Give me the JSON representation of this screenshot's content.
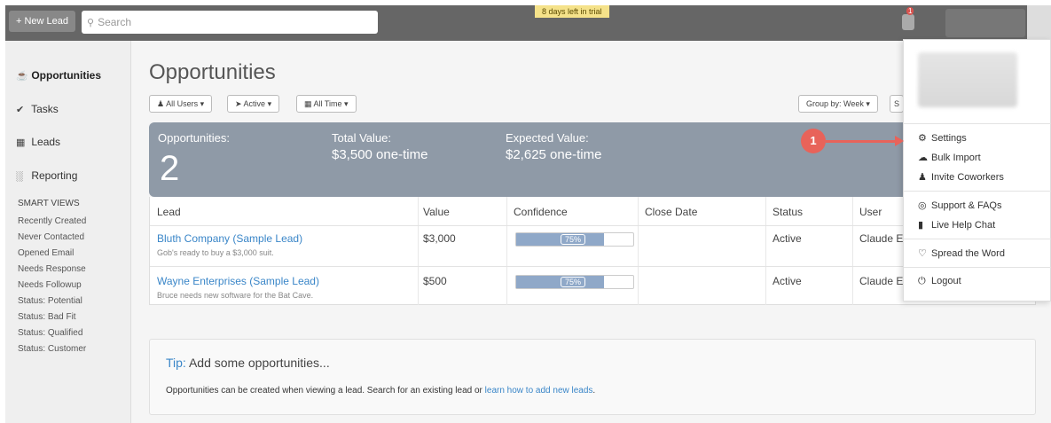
{
  "topbar": {
    "new_lead_label": "+ New Lead",
    "search_placeholder": "Search",
    "trial_text": "8 days left in trial",
    "notification_count": "1"
  },
  "sidebar": {
    "nav": [
      {
        "label": "Opportunities",
        "icon": "trophy-icon"
      },
      {
        "label": "Tasks",
        "icon": "check-icon"
      },
      {
        "label": "Leads",
        "icon": "leads-icon"
      },
      {
        "label": "Reporting",
        "icon": "bar-chart-icon"
      }
    ],
    "smart_views_heading": "SMART VIEWS",
    "smart_views": [
      "Recently Created",
      "Never Contacted",
      "Opened Email",
      "Needs Response",
      "Needs Followup",
      "Status: Potential",
      "Status: Bad Fit",
      "Status: Qualified",
      "Status: Customer"
    ]
  },
  "main": {
    "title": "Opportunities",
    "filters": {
      "users": "All Users",
      "status": "Active",
      "time": "All Time",
      "group_by": "Group by: Week",
      "truncated": "S"
    },
    "summary": {
      "count_label": "Opportunities:",
      "count_value": "2",
      "total_label": "Total Value:",
      "total_value": "$3,500 one-time",
      "expected_label": "Expected Value:",
      "expected_value": "$2,625 one-time"
    },
    "table": {
      "headers": [
        "Lead",
        "Value",
        "Confidence",
        "Close Date",
        "Status",
        "User"
      ],
      "rows": [
        {
          "lead": "Bluth Company (Sample Lead)",
          "note": "Gob's ready to buy a $3,000 suit.",
          "value": "$3,000",
          "confidence": "75%",
          "confidence_pct": 75,
          "close_date": "",
          "status": "Active",
          "user": "Claude El"
        },
        {
          "lead": "Wayne Enterprises (Sample Lead)",
          "note": "Bruce needs new software for the Bat Cave.",
          "value": "$500",
          "confidence": "75%",
          "confidence_pct": 75,
          "close_date": "",
          "status": "Active",
          "user": "Claude El"
        }
      ]
    },
    "tip": {
      "label": "Tip:",
      "heading": "Add some opportunities...",
      "body": "Opportunities can be created when viewing a lead. Search for an existing lead or",
      "link": "learn how to add new leads",
      "end": "."
    }
  },
  "dropdown": {
    "items": [
      {
        "label": "Settings",
        "icon": "gear-icon"
      },
      {
        "label": "Bulk Import",
        "icon": "cloud-upload-icon"
      },
      {
        "label": "Invite Coworkers",
        "icon": "users-icon"
      },
      {
        "label": "Support & FAQs",
        "icon": "lifebuoy-icon"
      },
      {
        "label": "Live Help Chat",
        "icon": "chat-icon"
      },
      {
        "label": "Spread the Word",
        "icon": "heart-icon"
      },
      {
        "label": "Logout",
        "icon": "power-icon"
      }
    ]
  },
  "callout": {
    "number": "1"
  },
  "colors": {
    "accent": "#3a86c8",
    "summary_bg": "#8f9aa7",
    "callout": "#e8635a"
  }
}
